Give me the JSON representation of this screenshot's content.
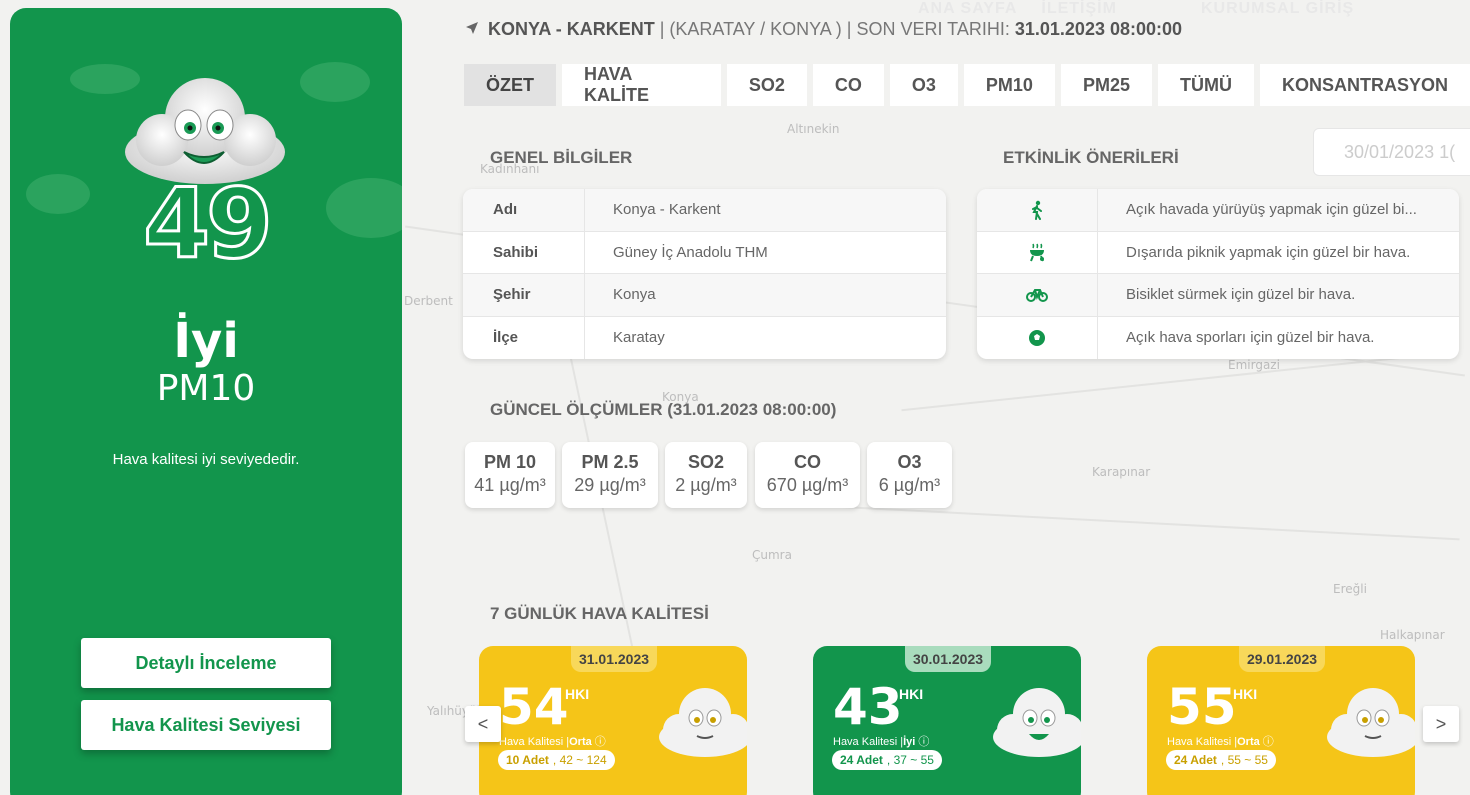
{
  "topnav": {
    "home": "ANA SAYFA",
    "contact": "İLETİŞİM",
    "login": "KURUMSAL GİRİŞ"
  },
  "location": {
    "station": "KONYA - KARKENT",
    "region": "(KARATAY / KONYA )",
    "last_label": "SON VERI TARIHI:",
    "last_date": "31.01.2023 08:00:00"
  },
  "tabs": [
    "ÖZET",
    "HAVA KALİTE",
    "SO2",
    "CO",
    "O3",
    "PM10",
    "PM25",
    "TÜMÜ",
    "KONSANTRASYON"
  ],
  "left_panel": {
    "aqi": "49",
    "status": "İyi",
    "parameter": "PM10",
    "description": "Hava kalitesi iyi seviyededir.",
    "btn_detail": "Detaylı İnceleme",
    "btn_levels": "Hava Kalitesi Seviyesi"
  },
  "general": {
    "title": "GENEL BİLGİLER",
    "rows": [
      {
        "k": "Adı",
        "v": "Konya - Karkent"
      },
      {
        "k": "Sahibi",
        "v": "Güney İç Anadolu THM"
      },
      {
        "k": "Şehir",
        "v": "Konya"
      },
      {
        "k": "İlçe",
        "v": "Karatay"
      }
    ]
  },
  "activities": {
    "title": "ETKİNLİK ÖNERİLERİ",
    "date_input": "30/01/2023 1(",
    "rows": [
      {
        "icon": "walking-icon",
        "text": "Açık havada yürüyüş yapmak için güzel bi..."
      },
      {
        "icon": "grill-icon",
        "text": "Dışarıda piknik yapmak için güzel bir hava."
      },
      {
        "icon": "bicycle-icon",
        "text": "Bisiklet sürmek için güzel bir hava."
      },
      {
        "icon": "football-icon",
        "text": "Açık hava sporları için güzel bir hava."
      }
    ]
  },
  "current": {
    "title": "GÜNCEL ÖLÇÜMLER (31.01.2023 08:00:00)",
    "items": [
      {
        "k": "PM 10",
        "v": "41 µg/m³"
      },
      {
        "k": "PM 2.5",
        "v": "29 µg/m³"
      },
      {
        "k": "SO2",
        "v": "2 µg/m³"
      },
      {
        "k": "CO",
        "v": "670 µg/m³"
      },
      {
        "k": "O3",
        "v": "6 µg/m³"
      }
    ]
  },
  "weekly": {
    "title": "7 GÜNLÜK HAVA KALİTESİ",
    "hki": "HKI",
    "caption": "Hava Kalitesi |",
    "days": [
      {
        "date": "31.01.2023",
        "value": "54",
        "level": "Orta",
        "count": "10 Adet",
        "range": ", 42 ~ 124",
        "color": "#f5c518"
      },
      {
        "date": "30.01.2023",
        "value": "43",
        "level": "İyi",
        "count": "24 Adet",
        "range": ", 37 ~ 55",
        "color": "#12954c"
      },
      {
        "date": "29.01.2023",
        "value": "55",
        "level": "Orta",
        "count": "24 Adet",
        "range": ", 55 ~ 55",
        "color": "#f5c518"
      }
    ],
    "prev": "<",
    "next": ">"
  },
  "map_labels": [
    "Altınekin",
    "Kadınhanı",
    "Derbent",
    "Konya",
    "Çumra",
    "Karapınar",
    "Ereğli",
    "Halkapınar",
    "Emirgazi",
    "Yalıhüyük"
  ]
}
